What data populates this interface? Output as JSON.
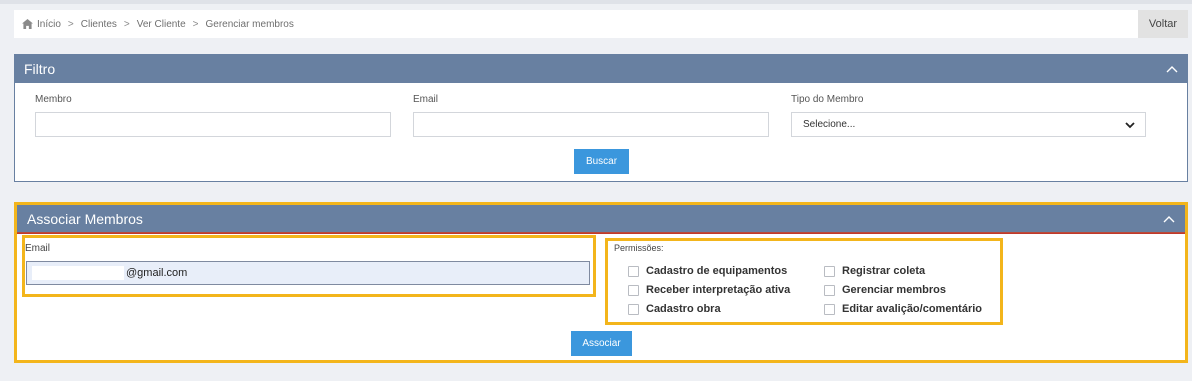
{
  "breadcrumb": {
    "items": [
      "Início",
      "Clientes",
      "Ver Cliente",
      "Gerenciar membros"
    ],
    "back_label": "Voltar"
  },
  "filter": {
    "title": "Filtro",
    "member_label": "Membro",
    "email_label": "Email",
    "type_label": "Tipo do Membro",
    "type_select_value": "Selecione...",
    "search_label": "Buscar"
  },
  "associate": {
    "title": "Associar Membros",
    "email_label": "Email",
    "email_value": "@gmail.com",
    "permissions_label": "Permissões:",
    "permissions": [
      "Cadastro de equipamentos",
      "Receber interpretação ativa",
      "Cadastro obra",
      "Registrar coleta",
      "Gerenciar membros",
      "Editar avalição/comentário"
    ],
    "submit_label": "Associar"
  },
  "colors": {
    "header": "#6880a1",
    "primary_button": "#3b97dd",
    "highlight": "#f3b51b"
  }
}
